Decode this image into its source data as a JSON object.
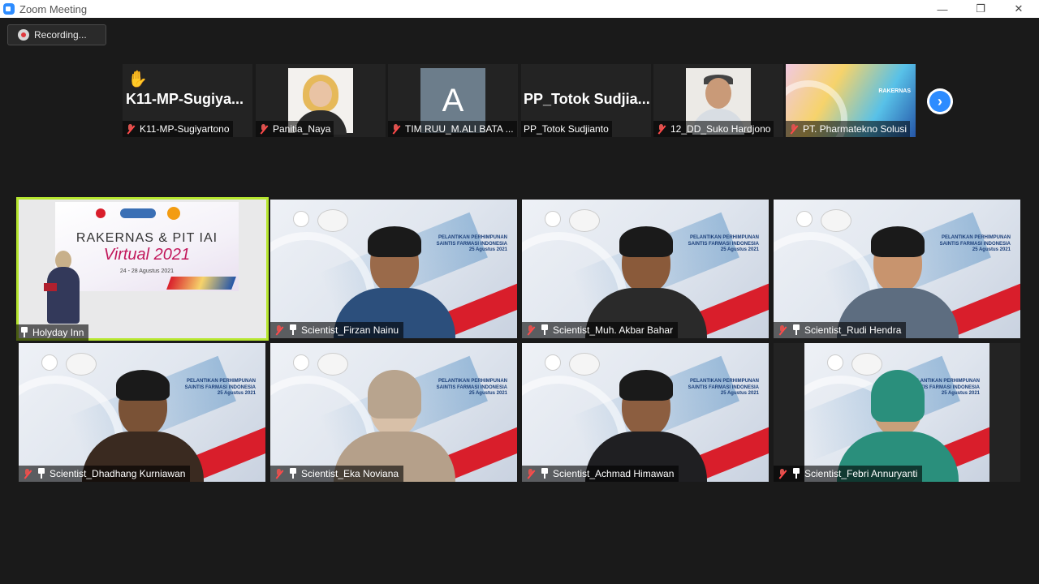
{
  "window": {
    "title": "Zoom Meeting",
    "controls": {
      "minimize": "—",
      "restore": "❐",
      "close": "✕"
    }
  },
  "recording": {
    "label": "Recording..."
  },
  "strip": [
    {
      "display_name": "K11-MP-Sugiya...",
      "label": "K11-MP-Sugiyartono",
      "raised_hand": "✋"
    },
    {
      "label": "Panitia_Naya"
    },
    {
      "avatar_letter": "A",
      "label": "TIM RUU_M.ALI BATA ..."
    },
    {
      "display_name": "PP_Totok  Sudjia...",
      "label": "PP_Totok Sudjianto"
    },
    {
      "label": "12_DD_Suko Hardjono"
    },
    {
      "label": "PT. Pharmatekno Solusi",
      "tile_text": "RAKERNAS"
    }
  ],
  "next_page": "›",
  "gallery": [
    {
      "label": "Holyday Inn",
      "slide": {
        "line1": "RAKERNAS & PIT IAI",
        "line2": "Virtual 2021",
        "line3": "24 - 28 Agustus 2021"
      }
    },
    {
      "label": "Scientist_Firzan Nainu"
    },
    {
      "label": "Scientist_Muh.  Akbar Bahar"
    },
    {
      "label": "Scientist_Rudi Hendra"
    },
    {
      "label": "Scientist_Dhadhang Kurniawan"
    },
    {
      "label": "Scientist_Eka Noviana"
    },
    {
      "label": "Scientist_Achmad Himawan"
    },
    {
      "label": "Scientist_Febri Annuryanti"
    }
  ],
  "background_text": {
    "line1": "PELANTIKAN PERHIMPUNAN",
    "line2": "SAINTIS FARMASI INDONESIA",
    "line3": "25 Agustus 2021"
  }
}
